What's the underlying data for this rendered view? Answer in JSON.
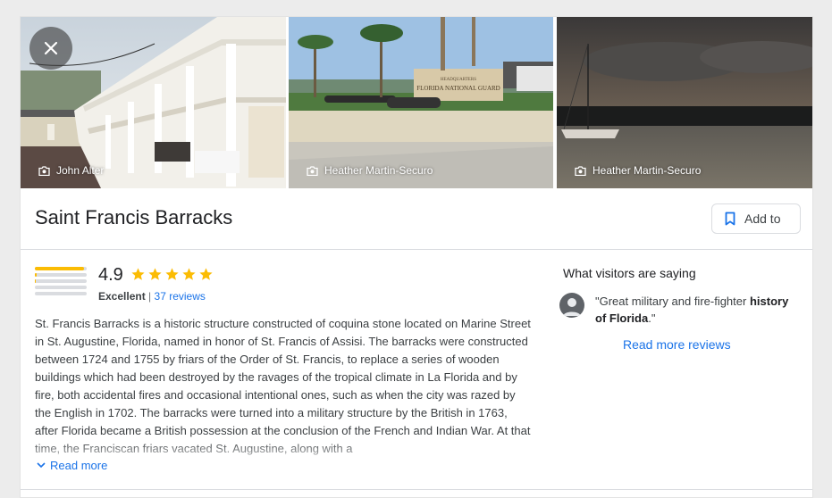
{
  "place": {
    "title": "Saint Francis Barracks",
    "add_to_label": "Add to"
  },
  "photos": [
    {
      "credit": "John Alter",
      "icon": "camera-icon"
    },
    {
      "credit": "Heather Martin-Securo",
      "icon": "camera-icon",
      "sign_text": "FLORIDA NATIONAL GUARD",
      "sign_small": "HEADQUARTERS"
    },
    {
      "credit": "Heather Martin-Securo",
      "icon": "camera-icon"
    }
  ],
  "rating": {
    "score": "4.9",
    "stars": 5,
    "label": "Excellent",
    "separator": "|",
    "reviews_link": "37 reviews",
    "distribution": [
      0.95,
      0.04,
      0.01,
      0.0,
      0.0
    ]
  },
  "description": {
    "text": "St. Francis Barracks is a historic structure constructed of coquina stone located on Marine Street in St. Augustine, Florida, named in honor of St. Francis of Assisi. The barracks were constructed between 1724 and 1755 by friars of the Order of St. Francis, to replace a series of wooden buildings which had been destroyed by the ravages of the tropical climate in La Florida and by fire, both accidental fires and occasional intentional ones, such as when the city was razed by the English in 1702. The barracks were turned into a military structure by the British in 1763, after Florida became a British possession at the conclusion of the French and Indian War. At that time, the Franciscan friars vacated St. Augustine, along with a",
    "read_more": "Read more"
  },
  "visitors": {
    "title": "What visitors are saying",
    "review_prefix": "\"Great military and fire-fighter ",
    "review_bold": "history of Florida",
    "review_suffix": ".\"",
    "more_reviews": "Read more reviews"
  },
  "colors": {
    "star": "#fbbc04",
    "link": "#1a73e8",
    "text": "#3c4043"
  }
}
